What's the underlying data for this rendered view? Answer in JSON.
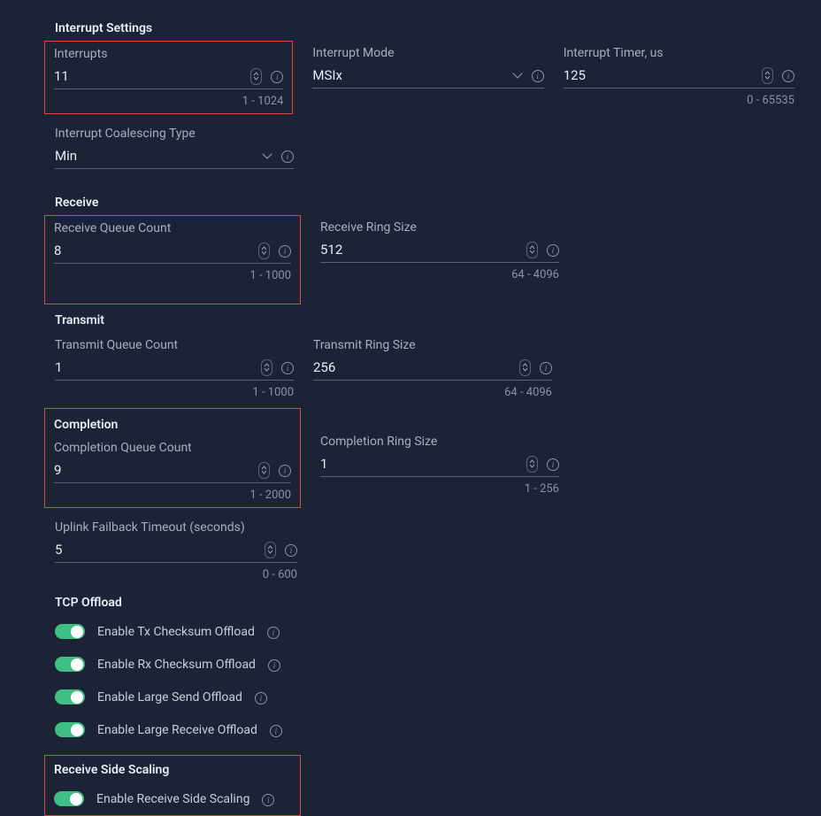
{
  "interruptSettings": {
    "title": "Interrupt Settings",
    "interrupts": {
      "label": "Interrupts",
      "value": "11",
      "range": "1 - 1024"
    },
    "mode": {
      "label": "Interrupt Mode",
      "value": "MSIx"
    },
    "timer": {
      "label": "Interrupt Timer, us",
      "value": "125",
      "range": "0 - 65535"
    },
    "coalescing": {
      "label": "Interrupt Coalescing Type",
      "value": "Min"
    }
  },
  "receive": {
    "title": "Receive",
    "queueCount": {
      "label": "Receive Queue Count",
      "value": "8",
      "range": "1 - 1000"
    },
    "ringSize": {
      "label": "Receive Ring Size",
      "value": "512",
      "range": "64 - 4096"
    }
  },
  "transmit": {
    "title": "Transmit",
    "queueCount": {
      "label": "Transmit Queue Count",
      "value": "1",
      "range": "1 - 1000"
    },
    "ringSize": {
      "label": "Transmit Ring Size",
      "value": "256",
      "range": "64 - 4096"
    }
  },
  "completion": {
    "title": "Completion",
    "queueCount": {
      "label": "Completion Queue Count",
      "value": "9",
      "range": "1 - 2000"
    },
    "ringSize": {
      "label": "Completion Ring Size",
      "value": "1",
      "range": "1 - 256"
    }
  },
  "uplink": {
    "label": "Uplink Failback Timeout (seconds)",
    "value": "5",
    "range": "0 - 600"
  },
  "tcpOffload": {
    "title": "TCP Offload",
    "txChecksum": "Enable Tx Checksum Offload",
    "rxChecksum": "Enable Rx Checksum Offload",
    "largeSend": "Enable Large Send Offload",
    "largeReceive": "Enable Large Receive Offload"
  },
  "rss": {
    "title": "Receive Side Scaling",
    "enable": "Enable Receive Side Scaling"
  }
}
